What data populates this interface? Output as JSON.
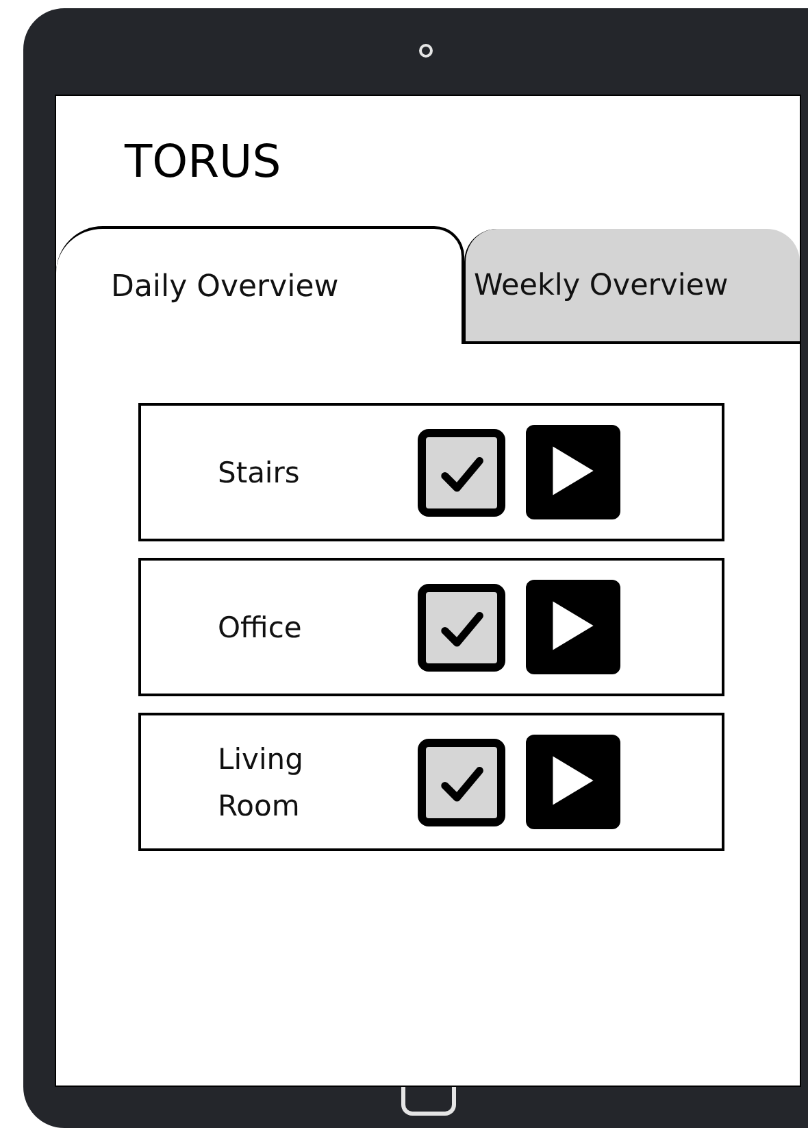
{
  "app": {
    "title": "TORUS"
  },
  "tabs": [
    {
      "label": "Daily Overview",
      "selected": true
    },
    {
      "label": "Weekly Overview",
      "selected": false
    }
  ],
  "rooms": [
    {
      "name": "Stairs",
      "checked": true
    },
    {
      "name": "Office",
      "checked": true
    },
    {
      "name": "Living Room",
      "checked": true
    }
  ]
}
